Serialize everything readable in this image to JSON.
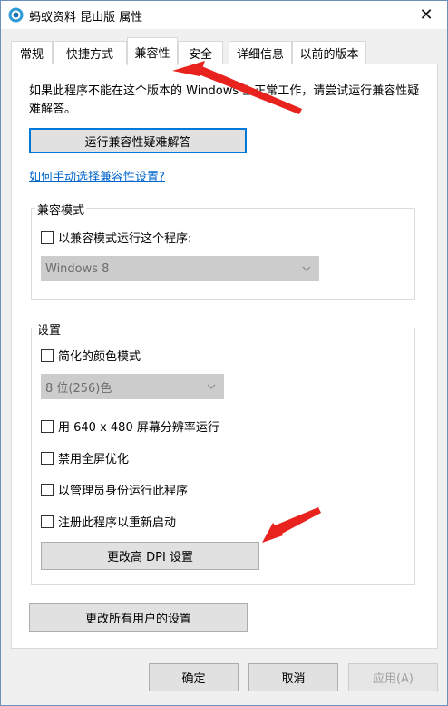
{
  "window": {
    "title": "蚂蚁资料 昆山版 属性",
    "close_symbol": "✕"
  },
  "tabs": [
    {
      "label": "常规",
      "active": false
    },
    {
      "label": "快捷方式",
      "active": false
    },
    {
      "label": "兼容性",
      "active": true
    },
    {
      "label": "安全",
      "active": false
    },
    {
      "label": "详细信息",
      "active": false
    },
    {
      "label": "以前的版本",
      "active": false
    }
  ],
  "compat": {
    "description": "如果此程序不能在这个版本的 Windows 上正常工作，请尝试运行兼容性疑难解答。",
    "troubleshoot_button": "运行兼容性疑难解答",
    "manual_link": "如何手动选择兼容性设置?"
  },
  "compat_mode": {
    "group_label": "兼容模式",
    "checkbox_label": "以兼容模式运行这个程序:",
    "checked": false,
    "os_select_value": "Windows 8"
  },
  "settings": {
    "group_label": "设置",
    "reduced_color_label": "简化的颜色模式",
    "color_select_value": "8 位(256)色",
    "run_640_label": "用 640 x 480 屏幕分辨率运行",
    "disable_fullscreen_label": "禁用全屏优化",
    "run_as_admin_label": "以管理员身份运行此程序",
    "register_restart_label": "注册此程序以重新启动",
    "change_dpi_button": "更改高 DPI 设置"
  },
  "all_users_button": "更改所有用户的设置",
  "dialog_buttons": {
    "ok": "确定",
    "cancel": "取消",
    "apply": "应用(A)"
  },
  "colors": {
    "link": "#0066cc",
    "annotation_arrow": "#e8231e",
    "focus_border": "#0078d7"
  },
  "icons": [
    "app-icon",
    "close-icon",
    "chevron-down-icon",
    "annotation-arrow"
  ]
}
